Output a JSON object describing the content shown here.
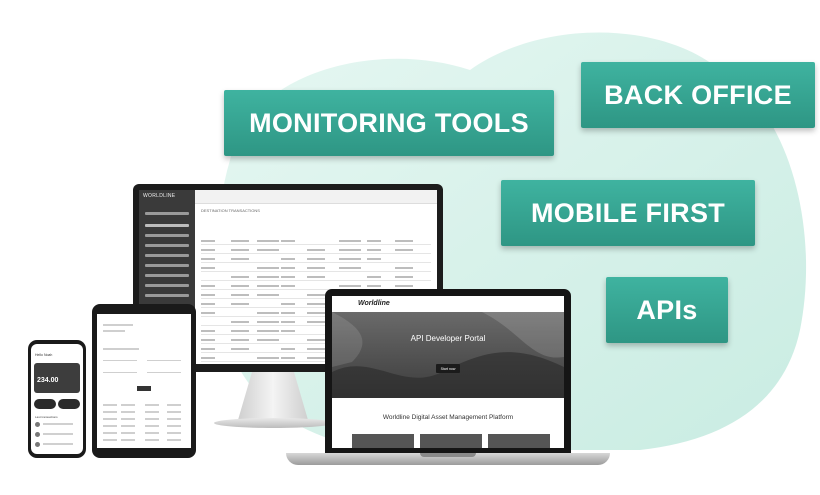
{
  "labels": {
    "monitoring_tools": "MONITORING TOOLS",
    "back_office": "BACK OFFICE",
    "mobile_first": "MOBILE FIRST",
    "apis": "APIs"
  },
  "monitor": {
    "logo": "WORLDLINE",
    "page_title": "DESTINATION TRANSACTIONS"
  },
  "laptop": {
    "brand": "Worldline",
    "hero_title": "API Developer Portal",
    "hero_button": "Start now",
    "subtitle": "Worldline Digital Asset Management Platform"
  },
  "phone": {
    "greeting": "Hello Noah",
    "amount": "234.00",
    "section_title": "Last transactions"
  },
  "colors": {
    "label_teal": "#35a592",
    "blob_mint": "#d7f1ea"
  }
}
